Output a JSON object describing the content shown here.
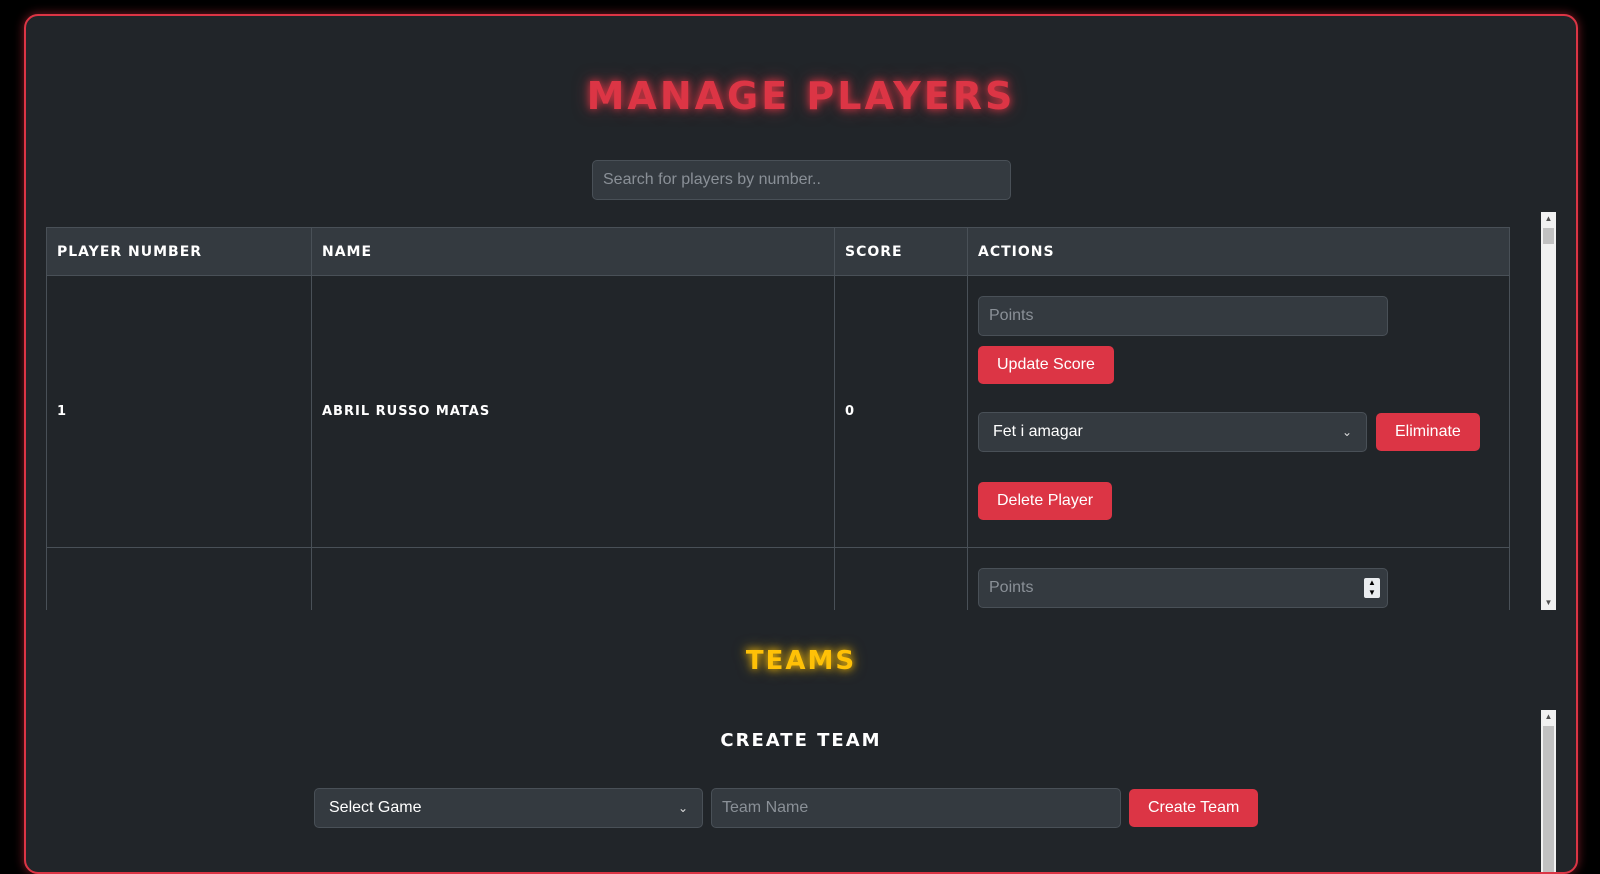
{
  "players_section": {
    "title": "Manage Players",
    "search_placeholder": "Search for players by number..",
    "columns": [
      "Player Number",
      "Name",
      "Score",
      "Actions"
    ],
    "rows": [
      {
        "number": "1",
        "name": "Abril Russo Matas",
        "score": "0",
        "points_placeholder": "Points",
        "update_label": "Update Score",
        "eliminate_select_value": "Fet i amagar",
        "eliminate_label": "Eliminate",
        "delete_label": "Delete Player"
      },
      {
        "number": "",
        "name": "",
        "score": "",
        "points_placeholder": "Points"
      }
    ]
  },
  "teams_section": {
    "title": "Teams",
    "create_title": "Create Team",
    "game_select_value": "Select Game",
    "team_name_placeholder": "Team Name",
    "create_label": "Create Team"
  },
  "colors": {
    "accent_red": "#dc3545",
    "accent_yellow": "#ffc107",
    "panel_bg": "#212529"
  }
}
